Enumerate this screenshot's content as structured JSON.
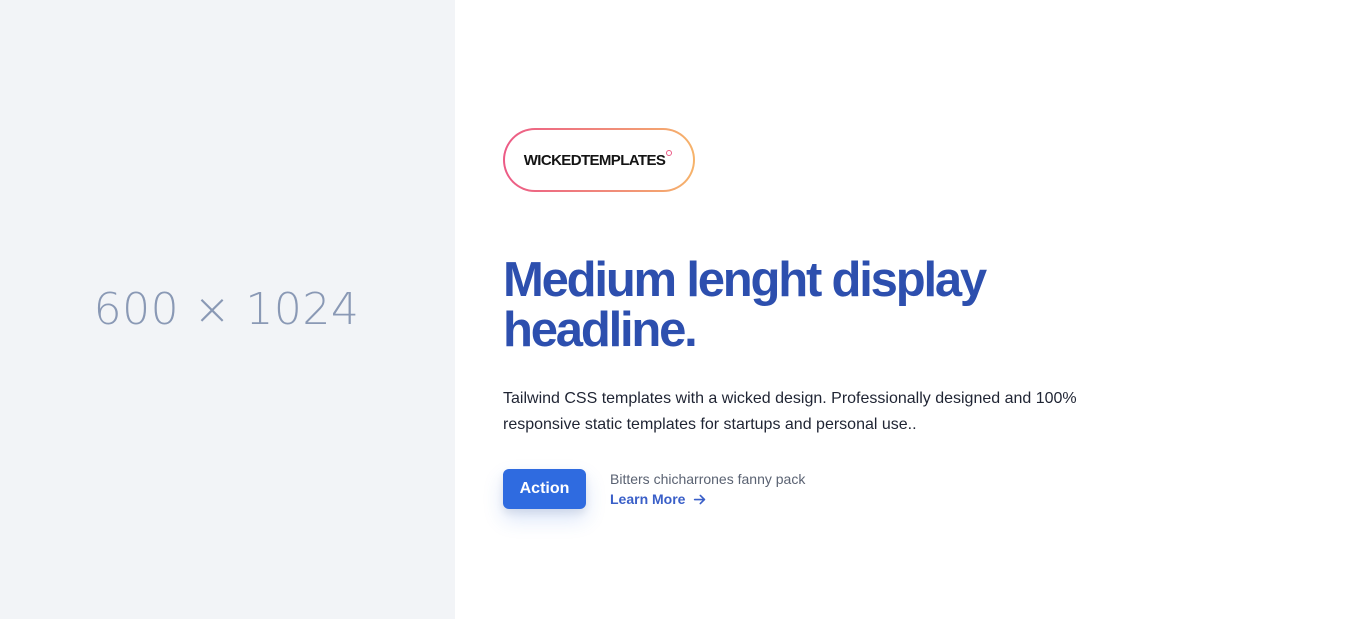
{
  "placeholder": {
    "text": "600 × 1024"
  },
  "logo": {
    "text": "WICKEDTEMPLATES",
    "icon": "logo-mark-icon",
    "gradient": [
      "#ec5a86",
      "#f6b36a"
    ]
  },
  "hero": {
    "headline": "Medium lenght display headline.",
    "description": "Tailwind CSS templates with a wicked design. Professionally designed and 100% responsive static templates for startups and personal use..",
    "action_label": "Action",
    "caption": "Bitters chicharrones fanny pack",
    "learn_more_label": "Learn More",
    "learn_more_icon": "arrow-right-icon"
  },
  "colors": {
    "headline": "#2d4fae",
    "button": "#2f6be0",
    "link": "#3a5fc8",
    "panel_bg": "#f2f4f7"
  }
}
